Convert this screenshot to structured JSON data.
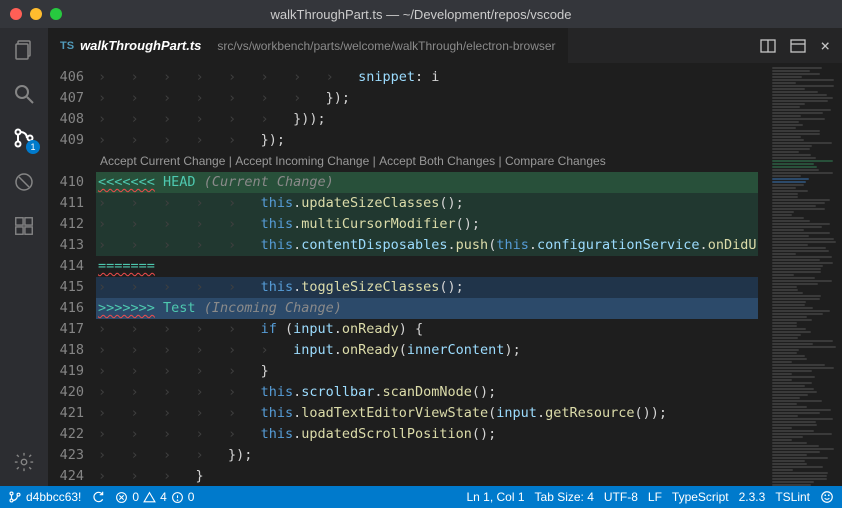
{
  "title": "walkThroughPart.ts — ~/Development/repos/vscode",
  "tab": {
    "icon": "TS",
    "name": "walkThroughPart.ts",
    "path": "src/vs/workbench/parts/welcome/walkThrough/electron-browser"
  },
  "scm_badge": "1",
  "codelens": {
    "accept_current": "Accept Current Change",
    "accept_incoming": "Accept Incoming Change",
    "accept_both": "Accept Both Changes",
    "compare": "Compare Changes"
  },
  "statusbar": {
    "branch": "d4bbcc63!",
    "errors": "0",
    "warnings": "4",
    "info": "0",
    "cursor": "Ln 1, Col 1",
    "tabsize": "Tab Size: 4",
    "encoding": "UTF-8",
    "eol": "LF",
    "lang": "TypeScript",
    "ts_version": "2.3.3",
    "lint": "TSLint"
  },
  "lines": [
    {
      "num": "406",
      "cls": "",
      "html": "<span class='tok-indent'>›   ›   ›   ›   ›   ›   ›   ›   </span><span class='tok-var'>snippet</span><span class='tok-p'>: i</span>"
    },
    {
      "num": "407",
      "cls": "",
      "html": "<span class='tok-indent'>›   ›   ›   ›   ›   ›   ›   </span><span class='tok-p'>});</span>"
    },
    {
      "num": "408",
      "cls": "",
      "html": "<span class='tok-indent'>›   ›   ›   ›   ›   ›   </span><span class='tok-p'>}));</span>"
    },
    {
      "num": "409",
      "cls": "",
      "html": "<span class='tok-indent'>›   ›   ›   ›   ›   </span><span class='tok-p'>});</span>"
    },
    {
      "num": "410",
      "cls": "bg-current",
      "html": "<span class='tok-conf squig'>&lt;&lt;&lt;&lt;&lt;&lt;&lt;</span><span class='tok-conf'> HEAD </span><span class='tok-grey'>(Current Change)</span>"
    },
    {
      "num": "411",
      "cls": "bg-current-soft",
      "html": "<span class='tok-indent'>›   ›   ›   ›   ›   </span><span class='tok-kw'>this</span><span class='tok-p'>.</span><span class='tok-fn'>updateSizeClasses</span><span class='tok-p'>();</span>"
    },
    {
      "num": "412",
      "cls": "bg-current-soft",
      "html": "<span class='tok-indent'>›   ›   ›   ›   ›   </span><span class='tok-kw'>this</span><span class='tok-p'>.</span><span class='tok-fn'>multiCursorModifier</span><span class='tok-p'>();</span>"
    },
    {
      "num": "413",
      "cls": "bg-current-soft",
      "html": "<span class='tok-indent'>›   ›   ›   ›   ›   </span><span class='tok-kw'>this</span><span class='tok-p'>.</span><span class='tok-var'>contentDisposables</span><span class='tok-p'>.</span><span class='tok-fn'>push</span><span class='tok-p'>(</span><span class='tok-kw'>this</span><span class='tok-p'>.</span><span class='tok-var'>configurationService</span><span class='tok-p'>.</span><span class='tok-fn'>onDidU</span>"
    },
    {
      "num": "414",
      "cls": "",
      "html": "<span class='tok-conf squig'>=======</span>"
    },
    {
      "num": "415",
      "cls": "bg-incoming-soft",
      "html": "<span class='tok-indent'>›   ›   ›   ›   ›   </span><span class='tok-kw'>this</span><span class='tok-p'>.</span><span class='tok-fn'>toggleSizeClasses</span><span class='tok-p'>();</span>"
    },
    {
      "num": "416",
      "cls": "bg-incoming",
      "html": "<span class='tok-conf squig'>&gt;&gt;&gt;&gt;&gt;&gt;&gt;</span><span class='tok-conf'> Test </span><span class='tok-grey'>(Incoming Change)</span>"
    },
    {
      "num": "417",
      "cls": "",
      "html": "<span class='tok-indent'>›   ›   ›   ›   ›   </span><span class='tok-kw'>if</span><span class='tok-p'> (</span><span class='tok-var'>input</span><span class='tok-p'>.</span><span class='tok-fn'>onReady</span><span class='tok-p'>) {</span>"
    },
    {
      "num": "418",
      "cls": "",
      "html": "<span class='tok-indent'>›   ›   ›   ›   ›   ›   </span><span class='tok-var'>input</span><span class='tok-p'>.</span><span class='tok-fn'>onReady</span><span class='tok-p'>(</span><span class='tok-var'>innerContent</span><span class='tok-p'>);</span>"
    },
    {
      "num": "419",
      "cls": "",
      "html": "<span class='tok-indent'>›   ›   ›   ›   ›   </span><span class='tok-p'>}</span>"
    },
    {
      "num": "420",
      "cls": "",
      "html": "<span class='tok-indent'>›   ›   ›   ›   ›   </span><span class='tok-kw'>this</span><span class='tok-p'>.</span><span class='tok-var'>scrollbar</span><span class='tok-p'>.</span><span class='tok-fn'>scanDomNode</span><span class='tok-p'>();</span>"
    },
    {
      "num": "421",
      "cls": "",
      "html": "<span class='tok-indent'>›   ›   ›   ›   ›   </span><span class='tok-kw'>this</span><span class='tok-p'>.</span><span class='tok-fn'>loadTextEditorViewState</span><span class='tok-p'>(</span><span class='tok-var'>input</span><span class='tok-p'>.</span><span class='tok-fn'>getResource</span><span class='tok-p'>());</span>"
    },
    {
      "num": "422",
      "cls": "",
      "html": "<span class='tok-indent'>›   ›   ›   ›   ›   </span><span class='tok-kw'>this</span><span class='tok-p'>.</span><span class='tok-fn'>updatedScrollPosition</span><span class='tok-p'>();</span>"
    },
    {
      "num": "423",
      "cls": "",
      "html": "<span class='tok-indent'>›   ›   ›   ›   </span><span class='tok-p'>});</span>"
    },
    {
      "num": "424",
      "cls": "",
      "html": "<span class='tok-indent'>›   ›   ›   </span><span class='tok-p'>}</span>"
    }
  ]
}
